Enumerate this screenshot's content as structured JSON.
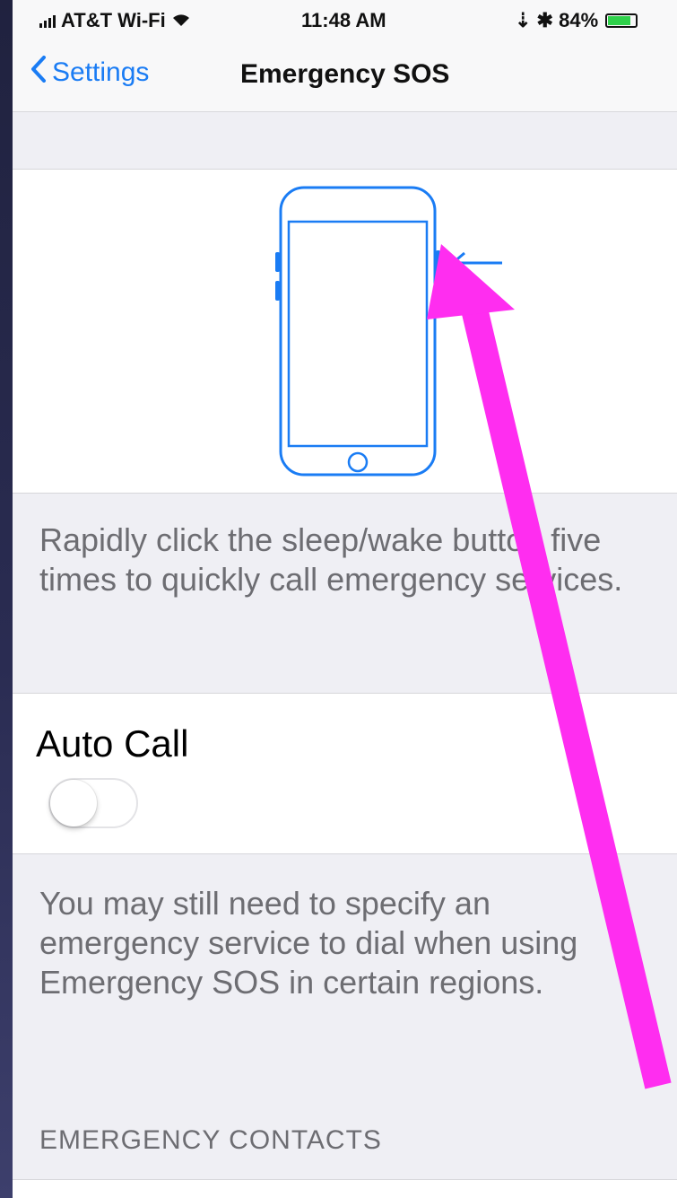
{
  "status_bar": {
    "carrier": "AT&T Wi-Fi",
    "wifi_symbol": "wifi-icon",
    "time": "11:48 AM",
    "indicators": "⇣ ✱ 84%",
    "battery_percent": 84
  },
  "nav": {
    "back_label": "Settings",
    "title": "Emergency SOS"
  },
  "illustration_caption": "Rapidly click the sleep/wake button five times to quickly call emergency services.",
  "auto_call": {
    "label": "Auto Call",
    "enabled": false
  },
  "auto_call_footer": "You may still need to specify an emergency service to dial when using Emergency SOS in certain regions.",
  "emergency_contacts_header": "EMERGENCY CONTACTS",
  "colors": {
    "accent": "#1a7cf4",
    "annotation_arrow": "#ff2df0",
    "battery": "#2fd14b"
  }
}
